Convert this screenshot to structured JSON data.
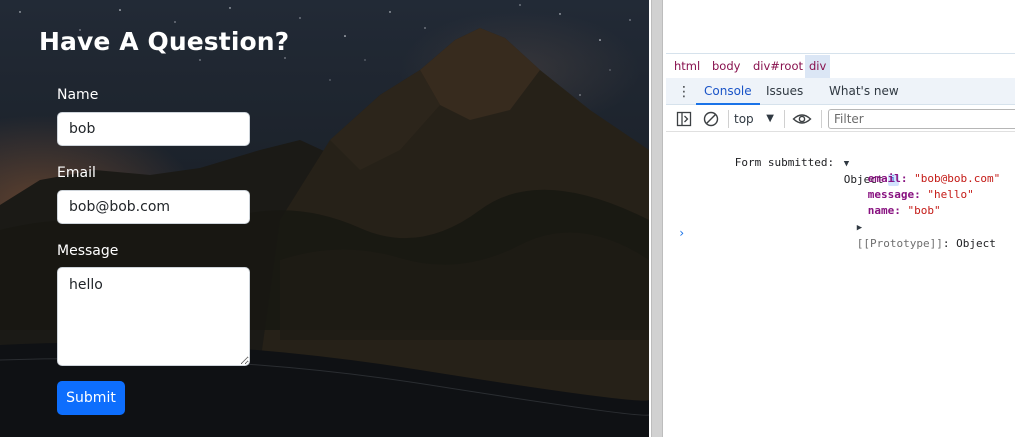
{
  "form": {
    "title": "Have A Question?",
    "name_label": "Name",
    "name_value": "bob",
    "email_label": "Email",
    "email_value": "bob@bob.com",
    "message_label": "Message",
    "message_value": "hello",
    "submit_label": "Submit",
    "submit_color": "#0d6efd"
  },
  "devtools": {
    "breadcrumbs": [
      "html",
      "body",
      "div#root",
      "div"
    ],
    "tabs": [
      "Console",
      "Issues",
      "What's new"
    ],
    "active_tab": "Console",
    "context": "top",
    "filter_placeholder": "Filter",
    "log": {
      "prefix": "Form submitted:",
      "object_label": "Object",
      "info_badge": "i",
      "props": [
        {
          "key": "email",
          "value": "\"bob@bob.com\""
        },
        {
          "key": "message",
          "value": "\"hello\""
        },
        {
          "key": "name",
          "value": "\"bob\""
        }
      ],
      "prototype_key": "[[Prototype]]",
      "prototype_value": "Object"
    },
    "prompt_symbol": "›"
  }
}
